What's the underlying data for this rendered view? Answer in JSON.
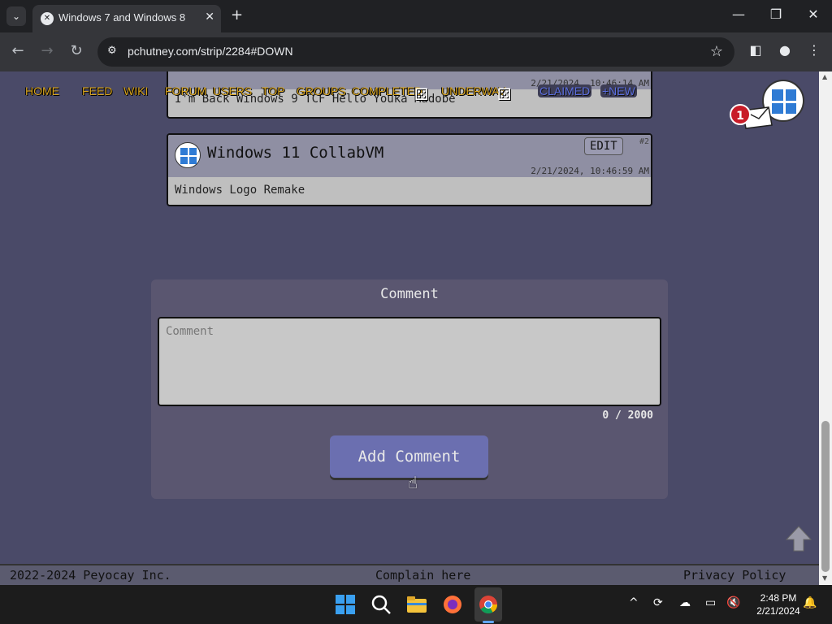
{
  "browser": {
    "tab_title": "Windows 7 and Windows 8",
    "url": "pchutney.com/strip/2284#DOWN"
  },
  "nav": {
    "home": "HOME",
    "feed": "FEED",
    "wiki": "WIKI",
    "forum": "FORUM",
    "users": "USERS",
    "top": "TOP",
    "groups": "GROUPS",
    "completed": "COMPLETED",
    "underway": "UNDERWAY",
    "claimed": "CLAIMED",
    "new": "+NEW"
  },
  "notification_count": "1",
  "comments": [
    {
      "title": "Windows 11 CollabVM",
      "edit_label": "EDIT",
      "number": "#2",
      "date": "2/21/2024, 10:46:59 AM",
      "body": "Windows Logo Remake"
    }
  ],
  "partial_comment": {
    "date": "2/21/2024, 10:46:14 AM",
    "body": "I'm Back Windows 9 TCF Hello Youka Madobe"
  },
  "comment_form": {
    "heading": "Comment",
    "placeholder": "Comment",
    "char_count": "0 / 2000",
    "submit_label": "Add Comment"
  },
  "footer": {
    "copyright": "2022-2024 Peyocay Inc.",
    "complain": "Complain here",
    "privacy": "Privacy Policy"
  },
  "taskbar": {
    "time": "2:48 PM",
    "date": "2/21/2024"
  },
  "colors": {
    "page_bg": "#4a4a68",
    "nav_link": "#d9a520",
    "button": "#6b6fb0"
  }
}
